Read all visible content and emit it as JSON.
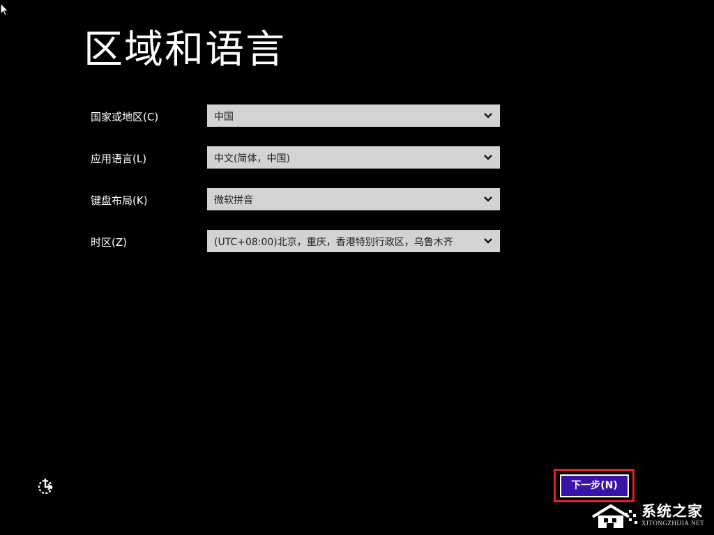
{
  "page": {
    "title": "区域和语言"
  },
  "form": {
    "fields": [
      {
        "label": "国家或地区(C)",
        "value": "中国"
      },
      {
        "label": "应用语言(L)",
        "value": "中文(简体，中国)"
      },
      {
        "label": "键盘布局(K)",
        "value": "微软拼音"
      },
      {
        "label": "时区(Z)",
        "value": "(UTC+08:00)北京，重庆，香港特别行政区，乌鲁木齐"
      }
    ]
  },
  "footer": {
    "next_label": "下一步(N)",
    "accessibility_icon": "ease-of-access-icon"
  },
  "watermark": {
    "name": "系统之家",
    "url": "XITONGZHIJIA.NET"
  },
  "colors": {
    "background": "#000000",
    "select_bg": "#d3d3d3",
    "button_bg": "#3a12a8",
    "highlight": "#e0202a"
  }
}
